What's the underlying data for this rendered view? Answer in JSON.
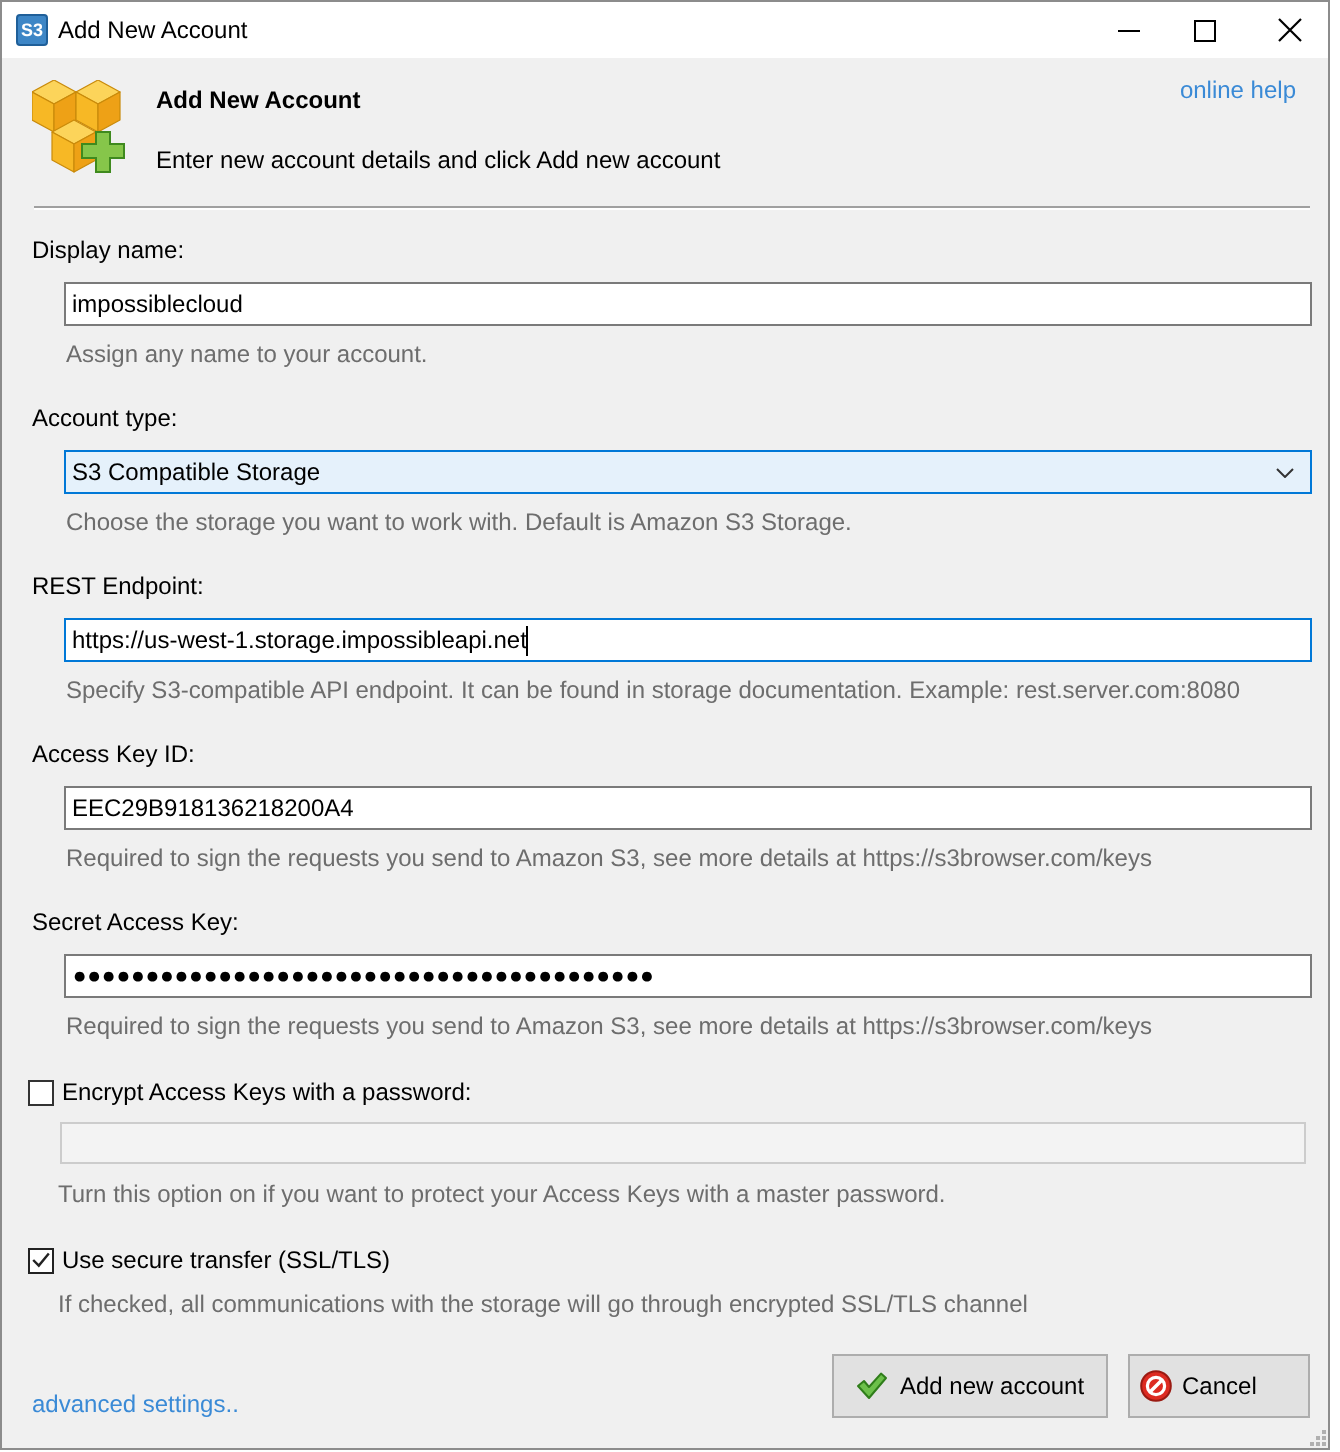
{
  "window": {
    "app_logo": "S3",
    "title": "Add New Account"
  },
  "header": {
    "title": "Add New Account",
    "subtitle": "Enter new account details and click Add new account",
    "help_link": "online help"
  },
  "fields": [
    {
      "kind": "text",
      "label": "Display name:",
      "value": "impossiblecloud",
      "active": false,
      "hint": "Assign any name to your account."
    },
    {
      "kind": "select",
      "label": "Account type:",
      "value": "S3 Compatible Storage",
      "active": true,
      "hint": "Choose the storage you want to work with. Default is Amazon S3 Storage."
    },
    {
      "kind": "text",
      "label": "REST Endpoint:",
      "value": "https://us-west-1.storage.impossibleapi.net",
      "active": true,
      "hint": "Specify S3-compatible API endpoint. It can be found in storage documentation. Example: rest.server.com:8080"
    },
    {
      "kind": "text",
      "label": "Access Key ID:",
      "value": "EEC29B918136218200A4",
      "active": false,
      "hint": "Required to sign the requests you send to Amazon S3, see more details at https://s3browser.com/keys"
    },
    {
      "kind": "password",
      "label": "Secret Access Key:",
      "value": "●●●●●●●●●●●●●●●●●●●●●●●●●●●●●●●●●●●●●●●●",
      "active": false,
      "hint": "Required to sign the requests you send to Amazon S3, see more details at https://s3browser.com/keys"
    }
  ],
  "options": [
    {
      "kind": "checkbox_with_field",
      "label": "Encrypt Access Keys with a password:",
      "checked": false,
      "field_disabled": true,
      "hint": "Turn this option on if you want to protect your Access Keys with a master password."
    },
    {
      "kind": "checkbox",
      "label": "Use secure transfer (SSL/TLS)",
      "checked": true,
      "hint": "If checked, all communications with the storage will go through encrypted SSL/TLS channel"
    }
  ],
  "footer": {
    "link": "advanced settings..",
    "buttons": [
      {
        "kind": "confirm",
        "label": "Add new account"
      },
      {
        "kind": "cancel",
        "label": "Cancel"
      }
    ]
  }
}
